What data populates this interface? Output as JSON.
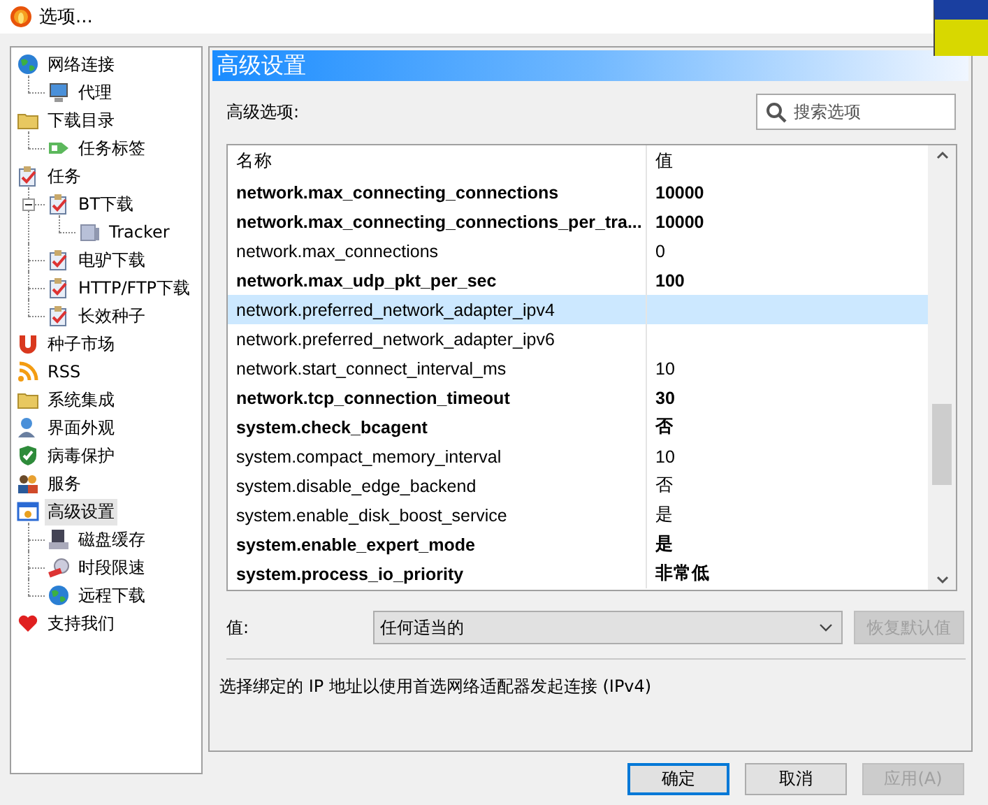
{
  "window": {
    "title": "选项..."
  },
  "sidebar": {
    "items": [
      {
        "label": "网络连接",
        "kind": "globe",
        "selected": false,
        "children": [
          {
            "label": "代理",
            "kind": "monitor",
            "selected": false
          }
        ]
      },
      {
        "label": "下载目录",
        "kind": "folder",
        "selected": false,
        "children": [
          {
            "label": "任务标签",
            "kind": "tag",
            "selected": false
          }
        ]
      },
      {
        "label": "任务",
        "kind": "clipboard",
        "selected": false,
        "children": [
          {
            "label": "BT下载",
            "kind": "clipboard",
            "selected": false,
            "expanded": true,
            "children": [
              {
                "label": "Tracker",
                "kind": "server",
                "selected": false
              }
            ]
          },
          {
            "label": "电驴下载",
            "kind": "clipboard",
            "selected": false
          },
          {
            "label": "HTTP/FTP下载",
            "kind": "clipboard",
            "selected": false
          },
          {
            "label": "长效种子",
            "kind": "clipboard",
            "selected": false
          }
        ]
      },
      {
        "label": "种子市场",
        "kind": "magnet",
        "selected": false
      },
      {
        "label": "RSS",
        "kind": "rss",
        "selected": false
      },
      {
        "label": "系统集成",
        "kind": "folder",
        "selected": false
      },
      {
        "label": "界面外观",
        "kind": "person",
        "selected": false
      },
      {
        "label": "病毒保护",
        "kind": "shield",
        "selected": false
      },
      {
        "label": "服务",
        "kind": "people",
        "selected": false
      },
      {
        "label": "高级设置",
        "kind": "window",
        "selected": true,
        "children": [
          {
            "label": "磁盘缓存",
            "kind": "disk",
            "selected": false
          },
          {
            "label": "时段限速",
            "kind": "gauge",
            "selected": false
          },
          {
            "label": "远程下载",
            "kind": "globe",
            "selected": false
          }
        ]
      },
      {
        "label": "支持我们",
        "kind": "heart",
        "selected": false
      }
    ]
  },
  "panel": {
    "title": "高级设置",
    "options_label": "高级选项:",
    "search": {
      "placeholder": "搜索选项"
    },
    "table": {
      "columns": [
        "名称",
        "值"
      ],
      "rows": [
        {
          "name": "network.max_connecting_connections",
          "value": "10000",
          "modified": true,
          "selected": false
        },
        {
          "name": "network.max_connecting_connections_per_tra...",
          "value": "10000",
          "modified": true,
          "selected": false
        },
        {
          "name": "network.max_connections",
          "value": "0",
          "modified": false,
          "selected": false
        },
        {
          "name": "network.max_udp_pkt_per_sec",
          "value": "100",
          "modified": true,
          "selected": false
        },
        {
          "name": "network.preferred_network_adapter_ipv4",
          "modified": false,
          "selected": true
        },
        {
          "name": "network.preferred_network_adapter_ipv6",
          "modified": false,
          "selected": false
        },
        {
          "name": "network.start_connect_interval_ms",
          "value": "10",
          "modified": false,
          "selected": false
        },
        {
          "name": "network.tcp_connection_timeout",
          "value": "30",
          "modified": true,
          "selected": false
        },
        {
          "name": "system.check_bcagent",
          "value": "否",
          "modified": true,
          "selected": false
        },
        {
          "name": "system.compact_memory_interval",
          "value": "10",
          "modified": false,
          "selected": false
        },
        {
          "name": "system.disable_edge_backend",
          "value": "否",
          "modified": false,
          "selected": false
        },
        {
          "name": "system.enable_disk_boost_service",
          "value": "是",
          "modified": false,
          "selected": false
        },
        {
          "name": "system.enable_expert_mode",
          "value": "是",
          "modified": true,
          "selected": false
        },
        {
          "name": "system.process_io_priority",
          "value": "非常低",
          "modified": true,
          "selected": false
        }
      ]
    },
    "value_label": "值:",
    "value": "任何适当的",
    "restore_button": {
      "label": "恢复默认值",
      "disabled": true
    },
    "description": "选择绑定的 IP 地址以使用首选网络适配器发起连接 (IPv4)"
  },
  "buttons": [
    {
      "label": "确定",
      "default": true,
      "disabled": false
    },
    {
      "label": "取消",
      "default": false,
      "disabled": false
    },
    {
      "label": "应用(A)",
      "default": false,
      "disabled": true
    }
  ]
}
